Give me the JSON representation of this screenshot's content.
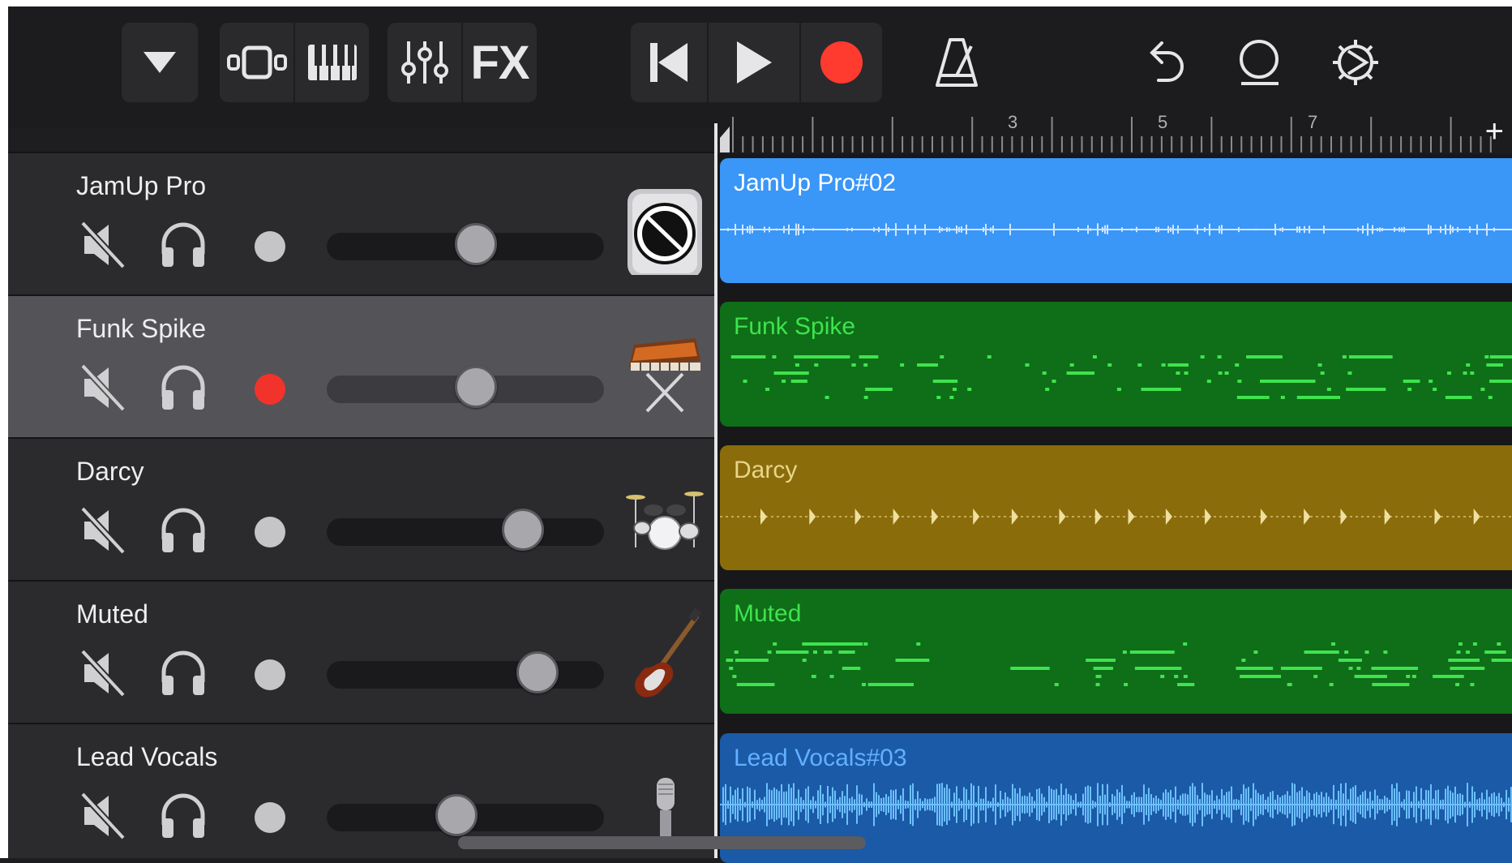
{
  "toolbar": {
    "buttons": [
      {
        "name": "browser-menu-button",
        "icon": "triangle-down-icon"
      },
      {
        "name": "track-view-button",
        "icon": "track-view-icon"
      },
      {
        "name": "keyboard-button",
        "icon": "piano-keys-icon"
      },
      {
        "name": "mixer-button",
        "icon": "sliders-icon"
      },
      {
        "name": "fx-button",
        "label": "FX"
      },
      {
        "name": "rewind-button",
        "icon": "skip-back-icon"
      },
      {
        "name": "play-button",
        "icon": "play-icon"
      },
      {
        "name": "record-button",
        "icon": "record-icon",
        "color": "#ff3b30"
      },
      {
        "name": "metronome-button",
        "icon": "metronome-icon"
      },
      {
        "name": "undo-button",
        "icon": "undo-icon"
      },
      {
        "name": "loop-browser-button",
        "icon": "loop-icon"
      },
      {
        "name": "settings-button",
        "icon": "gear-icon"
      }
    ],
    "fx_label": "FX"
  },
  "ruler": {
    "bar_numbers": [
      "3",
      "5",
      "7"
    ],
    "add_section_label": "+"
  },
  "tracks": [
    {
      "name": "JamUp Pro",
      "icon": "amp-knob-icon",
      "record_armed": false,
      "volume": 0.53,
      "selected": false,
      "region": {
        "name": "JamUp Pro#02",
        "color": "#3a96f7",
        "text_color": "#ffffff",
        "kind": "audio"
      }
    },
    {
      "name": "Funk Spike",
      "icon": "synthesizer-icon",
      "record_armed": true,
      "volume": 0.53,
      "selected": true,
      "region": {
        "name": "Funk Spike",
        "color": "#0f6e18",
        "text_color": "#3fe34e",
        "kind": "midi"
      }
    },
    {
      "name": "Darcy",
      "icon": "drum-kit-icon",
      "record_armed": false,
      "volume": 0.7,
      "selected": false,
      "region": {
        "name": "Darcy",
        "color": "#8a6c0b",
        "text_color": "#e8d58a",
        "kind": "drums"
      }
    },
    {
      "name": "Muted",
      "icon": "bass-guitar-icon",
      "record_armed": false,
      "volume": 0.75,
      "selected": false,
      "region": {
        "name": "Muted",
        "color": "#0f6e18",
        "text_color": "#3fe34e",
        "kind": "midi"
      }
    },
    {
      "name": "Lead Vocals",
      "icon": "microphone-icon",
      "record_armed": false,
      "volume": 0.46,
      "selected": false,
      "region": {
        "name": "Lead Vocals#03",
        "color": "#1a5aa6",
        "text_color": "#63b0ff",
        "kind": "vocal"
      }
    }
  ]
}
